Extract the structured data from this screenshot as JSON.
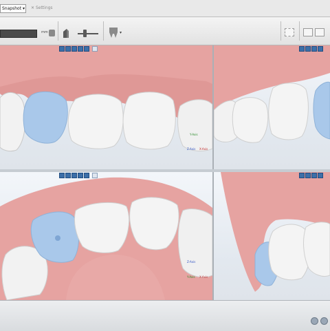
{
  "top_bar": {
    "snapshot_label": "Snapshot",
    "settings_label": "Settings"
  },
  "toolbar": {
    "unit_label": "mm"
  },
  "views": {
    "labial_right": {
      "axis_y": "Y-Axis",
      "axis_z": "Z-Axis",
      "axis_x": "X-Axis"
    },
    "occlusal": {
      "axis_y": "Y-Axis",
      "axis_z": "Z-Axis",
      "axis_x": "X-Axis"
    }
  },
  "colors": {
    "gingiva": "#e6a3a1",
    "tooth": "#f4f4f4",
    "tooth_selected": "#a9c8ea",
    "view_bg": "#eef2f6"
  },
  "icons": {
    "view_toolbar": [
      "view-icon",
      "view-icon",
      "view-icon",
      "view-icon",
      "view-icon",
      "maximize-icon"
    ],
    "status": [
      "zoom-icon",
      "search-icon"
    ]
  }
}
